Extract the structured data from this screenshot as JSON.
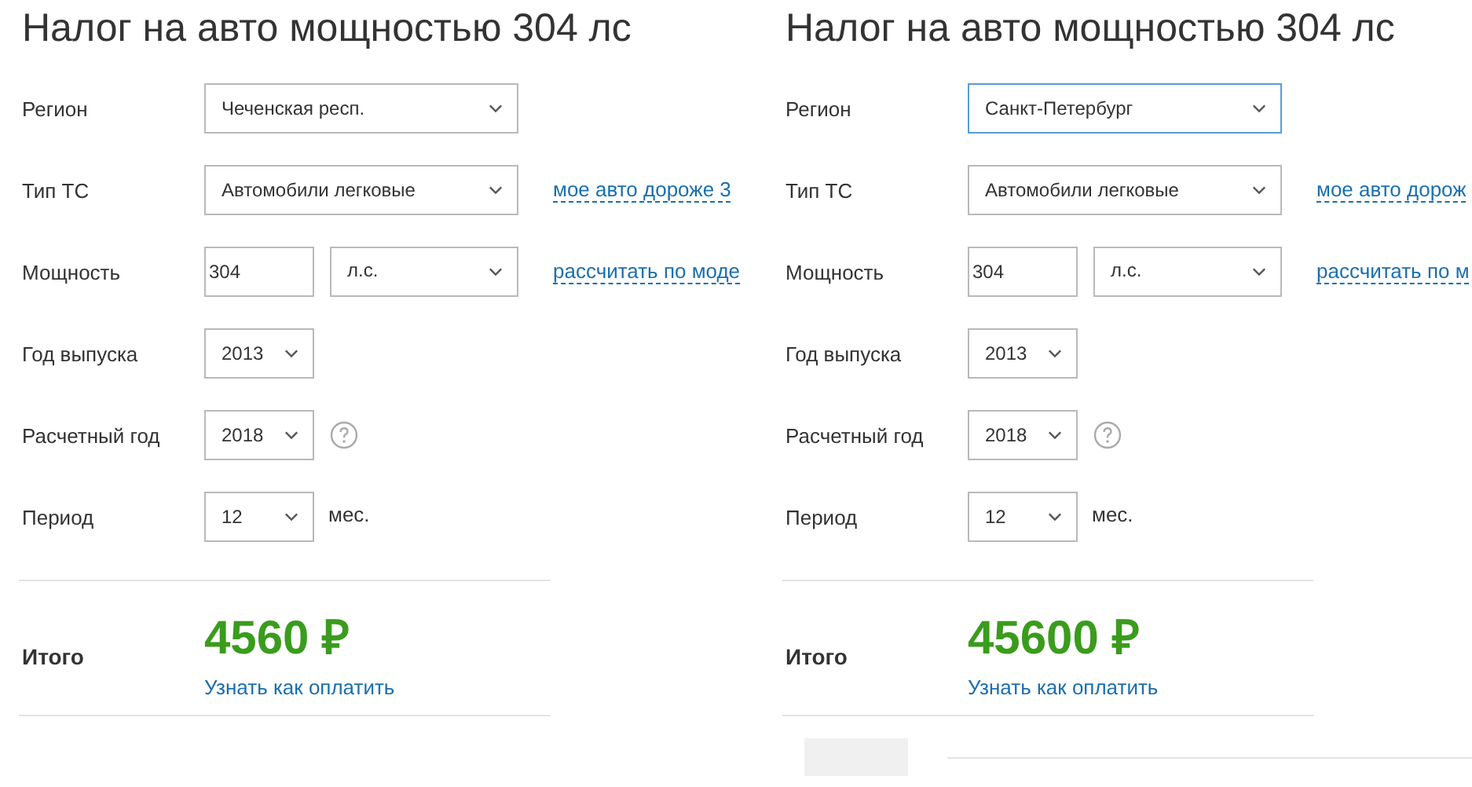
{
  "panels": [
    {
      "title": "Налог на авто мощностью 304 лс",
      "rows": [
        {
          "label": "Регион",
          "controls": [
            {
              "kind": "wide_select",
              "value": "Чеченская респ.",
              "focused": false
            }
          ]
        },
        {
          "label": "Тип ТС",
          "controls": [
            {
              "kind": "wide_select",
              "value": "Автомобили легковые",
              "focused": false
            },
            {
              "kind": "link",
              "text": "мое авто дороже 3"
            }
          ]
        },
        {
          "label": "Мощность",
          "controls": [
            {
              "kind": "input",
              "value": "304"
            },
            {
              "kind": "unit_select",
              "value": "л.с.",
              "focused": false
            },
            {
              "kind": "link",
              "text": "рассчитать по моде"
            }
          ]
        },
        {
          "label": "Год выпуска",
          "controls": [
            {
              "kind": "small_select",
              "value": "2013",
              "focused": false
            }
          ]
        },
        {
          "label": "Расчетный год",
          "controls": [
            {
              "kind": "small_select",
              "value": "2018",
              "focused": false
            },
            {
              "kind": "help"
            }
          ]
        },
        {
          "label": "Период",
          "controls": [
            {
              "kind": "small_select",
              "value": "12",
              "focused": false
            },
            {
              "kind": "suffix",
              "text": "мес."
            }
          ]
        }
      ],
      "total": {
        "label": "Итого",
        "amount": "4560 ₽",
        "pay_link": "Узнать как оплатить"
      }
    },
    {
      "title": "Налог на авто мощностью 304 лс",
      "rows": [
        {
          "label": "Регион",
          "controls": [
            {
              "kind": "wide_select",
              "value": "Санкт-Петербург",
              "focused": true
            }
          ]
        },
        {
          "label": "Тип ТС",
          "controls": [
            {
              "kind": "wide_select",
              "value": "Автомобили легковые",
              "focused": false
            },
            {
              "kind": "link",
              "text": "мое авто дорож"
            }
          ]
        },
        {
          "label": "Мощность",
          "controls": [
            {
              "kind": "input",
              "value": "304"
            },
            {
              "kind": "unit_select",
              "value": "л.с.",
              "focused": false
            },
            {
              "kind": "link",
              "text": "рассчитать по м"
            }
          ]
        },
        {
          "label": "Год выпуска",
          "controls": [
            {
              "kind": "small_select",
              "value": "2013",
              "focused": false
            }
          ]
        },
        {
          "label": "Расчетный год",
          "controls": [
            {
              "kind": "small_select",
              "value": "2018",
              "focused": false
            },
            {
              "kind": "help"
            }
          ]
        },
        {
          "label": "Период",
          "controls": [
            {
              "kind": "small_select",
              "value": "12",
              "focused": false
            },
            {
              "kind": "suffix",
              "text": "мес."
            }
          ]
        }
      ],
      "total": {
        "label": "Итого",
        "amount": "45600 ₽",
        "pay_link": "Узнать как оплатить"
      },
      "more_below": true
    }
  ]
}
